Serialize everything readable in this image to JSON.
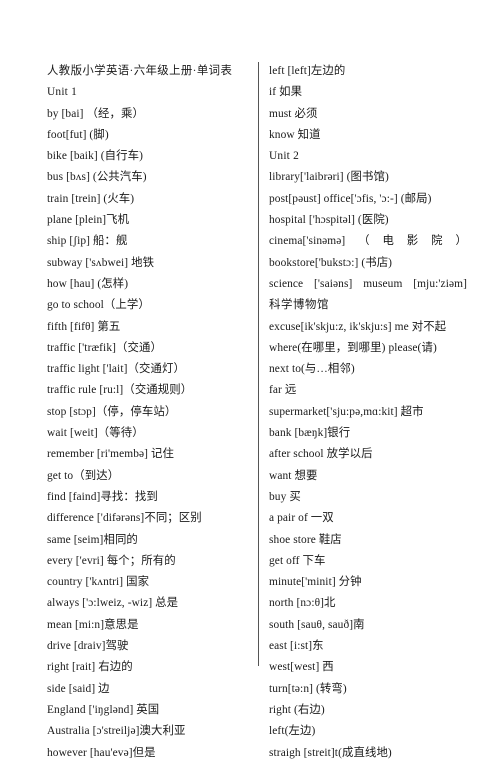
{
  "document": {
    "title": "人教版小学英语·六年级上册·单词表",
    "text_color": "#1a1a1a",
    "rule_color": "#555555",
    "background": "#ffffff"
  },
  "left_column": {
    "lines": [
      {
        "text": "人教版小学英语·六年级上册·单词表",
        "style": "title"
      },
      {
        "text": "Unit 1",
        "style": "unit"
      },
      {
        "text": "by [bai]  （经，乘）"
      },
      {
        "text": "foot[fut] (脚)"
      },
      {
        "text": "bike [baik] (自行车)"
      },
      {
        "text": "bus [bʌs] (公共汽车)"
      },
      {
        "text": "train [trein] (火车)"
      },
      {
        "text": "plane [plein]飞机"
      },
      {
        "text": "ship [ʃip]   船：舰"
      },
      {
        "text": "subway ['sʌbwei]   地铁"
      },
      {
        "text": "how [hau] (怎样)"
      },
      {
        "text": "go to school（上学）"
      },
      {
        "text": "fifth [fifθ]   第五"
      },
      {
        "text": "traffic ['træfik]（交通）"
      },
      {
        "text": "traffic light ['lait]（交通灯）"
      },
      {
        "text": "traffic rule [ru:l]（交通规则）"
      },
      {
        "text": "stop [stɔp]（停，停车站）"
      },
      {
        "text": "wait [weit]（等待）"
      },
      {
        "text": "remember [ri'membə]   记住"
      },
      {
        "text": "get to（到达）"
      },
      {
        "text": "find [faind]寻找：找到"
      },
      {
        "text": "difference ['difərəns]不同；区别"
      },
      {
        "text": "same [seim]相同的"
      },
      {
        "text": "every ['evri]   每个；所有的"
      },
      {
        "text": "country ['kʌntri]   国家"
      },
      {
        "text": "always ['ɔ:lweiz, -wiz] 总是"
      },
      {
        "text": "mean [mi:n]意思是"
      },
      {
        "text": "drive [draiv]驾驶"
      },
      {
        "text": "right [rait]   右边的"
      },
      {
        "text": "side [said]    边"
      },
      {
        "text": "England ['iŋglənd]   英国"
      },
      {
        "text": "Australia [ɔ'streiljə]澳大利亚"
      },
      {
        "text": "however [hau'evə]但是"
      }
    ]
  },
  "right_column": {
    "lines": [
      {
        "text": "left [left]左边的"
      },
      {
        "text": "if  如果"
      },
      {
        "text": "must  必须"
      },
      {
        "text": "know  知道"
      },
      {
        "text": "Unit 2",
        "style": "unit"
      },
      {
        "text": "library['laibrəri] (图书馆)"
      },
      {
        "text": "post[pəust] office['ɔfis, 'ɔ:-] (邮局)"
      },
      {
        "text": "hospital ['hɔspitəl] (医院)"
      },
      {
        "justified": [
          "cinema['sinəmə]",
          "（",
          "电",
          "影",
          "院",
          "）"
        ]
      },
      {
        "text": "bookstore['bukstɔ:] (书店)"
      },
      {
        "justified": [
          "science",
          "['saiəns]",
          "museum",
          "[mju:'ziəm]"
        ]
      },
      {
        "text": "科学博物馆",
        "style": "cjk"
      },
      {
        "text": "excuse[ik'skju:z, ik'skju:s] me  对不起"
      },
      {
        "text": "where(在哪里，到哪里)   please(请)"
      },
      {
        "text": "next to(与…相邻)"
      },
      {
        "text": "far  远"
      },
      {
        "text": "supermarket['sju:pə,mɑ:kit]    超市"
      },
      {
        "text": "bank [bæŋk]银行"
      },
      {
        "text": "after school  放学以后"
      },
      {
        "text": "want  想要"
      },
      {
        "text": "buy  买"
      },
      {
        "text": "a pair of  一双"
      },
      {
        "text": "shoe store  鞋店"
      },
      {
        "text": "get off  下车"
      },
      {
        "text": "minute['minit]    分钟"
      },
      {
        "text": "north [nɔ:θ]北"
      },
      {
        "text": "south [sauθ, sauð]南"
      },
      {
        "text": "east [i:st]东"
      },
      {
        "text": "west[west]  西"
      },
      {
        "text": "turn[tə:n] (转弯)"
      },
      {
        "text": "right (右边)"
      },
      {
        "text": "left(左边)"
      },
      {
        "text": "straigh [streit]t(成直线地)"
      }
    ]
  }
}
